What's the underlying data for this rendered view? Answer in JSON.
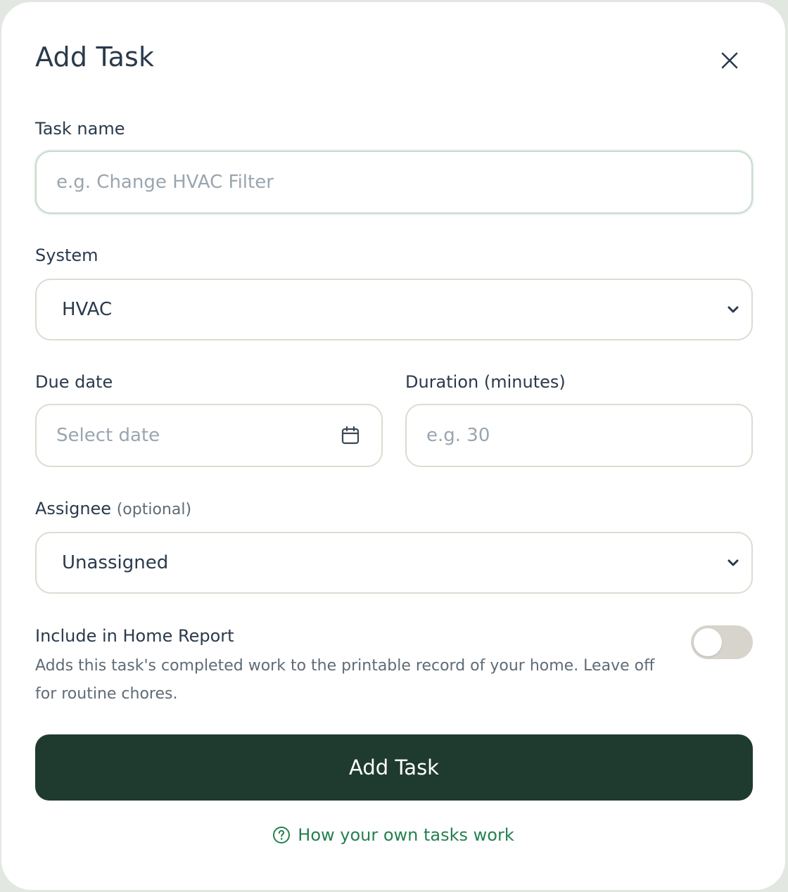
{
  "modal": {
    "title": "Add Task",
    "close_icon": "close-icon"
  },
  "form": {
    "task_name": {
      "label": "Task name",
      "placeholder": "e.g. Change HVAC Filter",
      "value": ""
    },
    "system": {
      "label": "System",
      "selected": "HVAC"
    },
    "due_date": {
      "label": "Due date",
      "placeholder": "Select date",
      "icon": "calendar-icon"
    },
    "duration": {
      "label": "Duration (minutes)",
      "placeholder": "e.g. 30"
    },
    "assignee": {
      "label": "Assignee",
      "optional_label": "(optional)",
      "selected": "Unassigned"
    },
    "home_report": {
      "title": "Include in Home Report",
      "description": "Adds this task's completed work to the printable record of your home. Leave off for routine chores.",
      "enabled": false
    },
    "submit_label": "Add Task",
    "help_link_label": "How your own tasks work",
    "help_icon": "question-circle-icon"
  },
  "colors": {
    "primary_button": "#1f3b30",
    "link": "#258050",
    "text": "#2a3a4c",
    "muted_text": "#5f6b76",
    "toggle_off": "#d7d4cc"
  }
}
